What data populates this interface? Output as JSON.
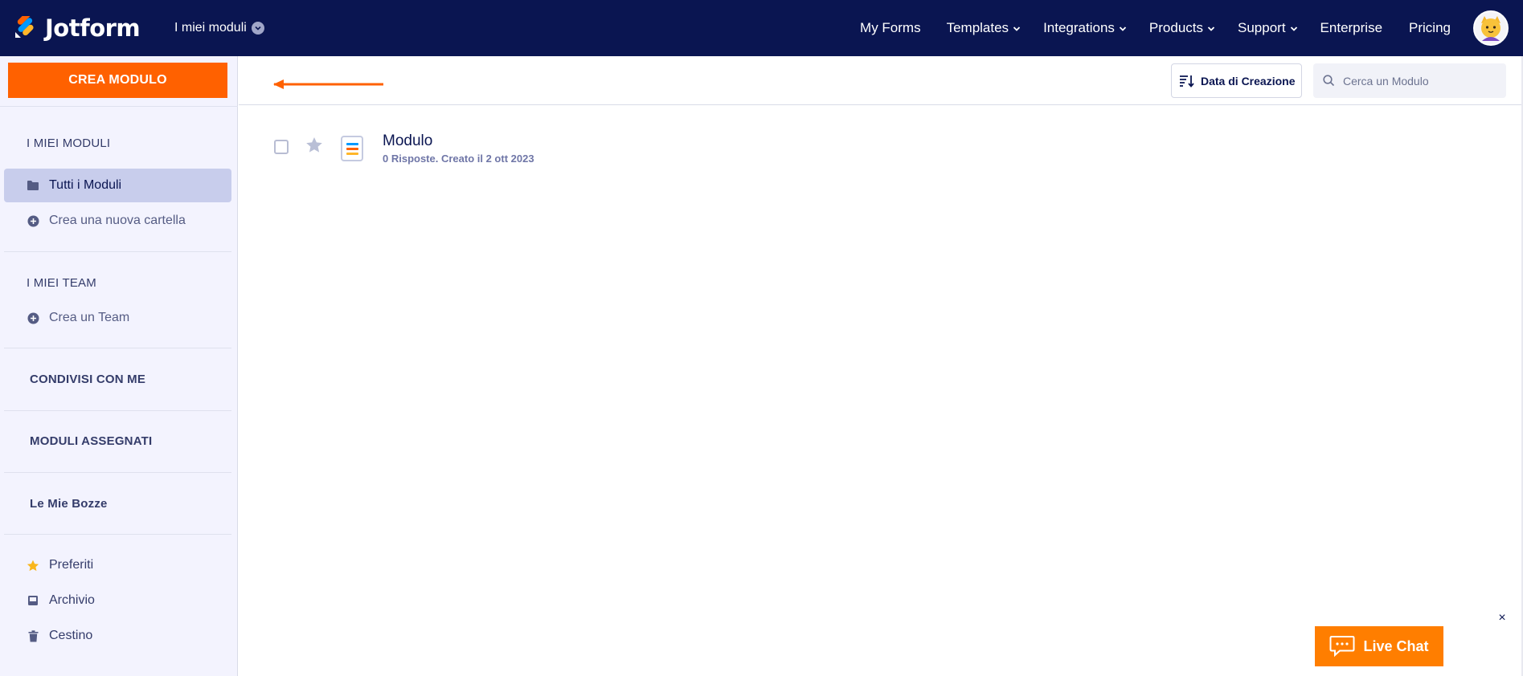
{
  "header": {
    "brand": "Jotform",
    "workspace_label": "I miei moduli",
    "nav": [
      {
        "label": "My Forms",
        "dropdown": false
      },
      {
        "label": "Templates",
        "dropdown": true
      },
      {
        "label": "Integrations",
        "dropdown": true
      },
      {
        "label": "Products",
        "dropdown": true
      },
      {
        "label": "Support",
        "dropdown": true
      },
      {
        "label": "Enterprise",
        "dropdown": false
      },
      {
        "label": "Pricing",
        "dropdown": false
      }
    ]
  },
  "sidebar": {
    "create_label": "CREA MODULO",
    "my_forms_title": "I MIEI MODULI",
    "all_forms": "Tutti i Moduli",
    "new_folder": "Crea una nuova cartella",
    "my_teams_title": "I MIEI TEAM",
    "create_team": "Crea un Team",
    "shared_with_me": "CONDIVISI CON ME",
    "assigned_forms": "MODULI ASSEGNATI",
    "drafts": "Le Mie Bozze",
    "favorites": "Preferiti",
    "archive": "Archivio",
    "trash": "Cestino"
  },
  "toolbar": {
    "sort_label": "Data di Creazione",
    "search_placeholder": "Cerca un Modulo"
  },
  "forms": [
    {
      "title": "Modulo",
      "meta": "0 Risposte. Creato il 2 ott 2023"
    }
  ],
  "live_chat": {
    "label": "Live Chat",
    "close": "×"
  },
  "colors": {
    "header_bg": "#0a1551",
    "accent": "#ff6100",
    "sidebar_bg": "#f3f3fe",
    "active_item": "#c8cdec",
    "live_chat": "#ff7e00"
  }
}
